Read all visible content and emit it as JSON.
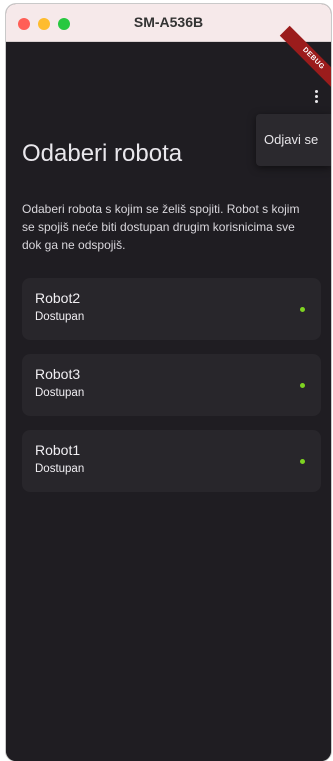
{
  "window": {
    "title": "SM-A536B"
  },
  "debug_banner": "DEBUG",
  "menu": {
    "icon": "more-vert-icon",
    "logout_label": "Odjavi se"
  },
  "page": {
    "title": "Odaberi robota",
    "description": "Odaberi robota s kojim se želiš spojiti. Robot s kojim se spojiš neće biti dostupan drugim korisnicima sve dok ga ne odspojiš."
  },
  "robots": [
    {
      "name": "Robot2",
      "status": "Dostupan"
    },
    {
      "name": "Robot3",
      "status": "Dostupan"
    },
    {
      "name": "Robot1",
      "status": "Dostupan"
    }
  ],
  "colors": {
    "background": "#1f1d22",
    "card": "#28262b",
    "status_available": "#7ed321"
  }
}
